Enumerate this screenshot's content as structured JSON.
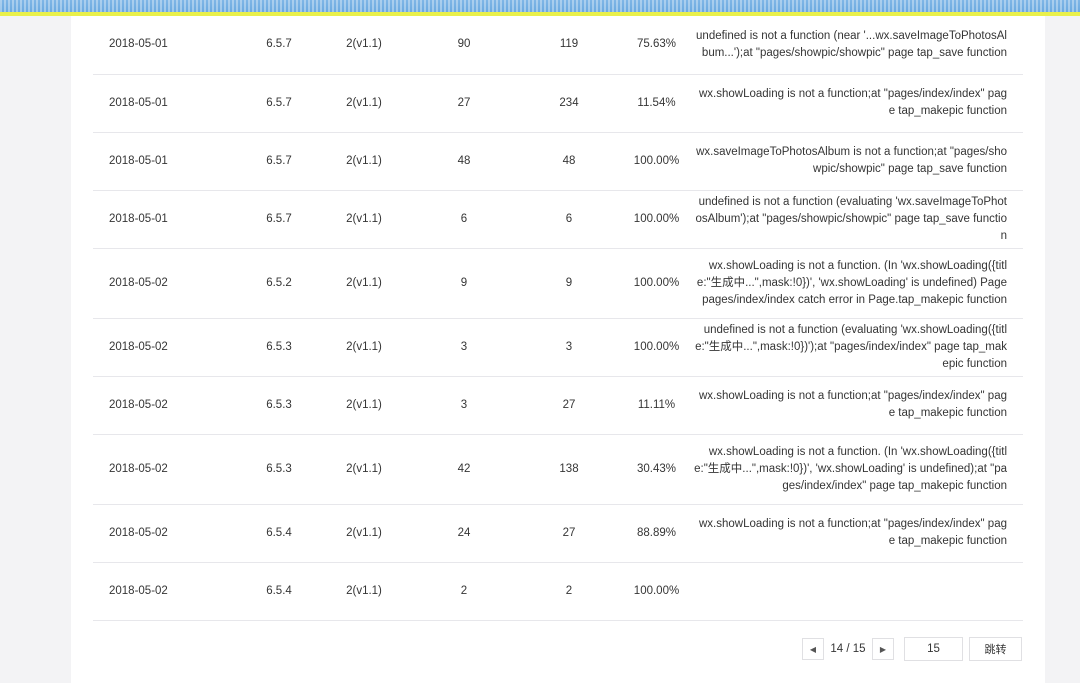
{
  "table": {
    "rows": [
      {
        "date": "2018-05-01",
        "version": "6.5.7",
        "base_lib": "2(v1.1)",
        "count": "90",
        "total": "119",
        "percent": "75.63%",
        "message": "undefined is not a function (near '...wx.saveImageToPhotosAlbum...');at \"pages/showpic/showpic\" page tap_save function"
      },
      {
        "date": "2018-05-01",
        "version": "6.5.7",
        "base_lib": "2(v1.1)",
        "count": "27",
        "total": "234",
        "percent": "11.54%",
        "message": "wx.showLoading is not a function;at \"pages/index/index\" page tap_makepic function"
      },
      {
        "date": "2018-05-01",
        "version": "6.5.7",
        "base_lib": "2(v1.1)",
        "count": "48",
        "total": "48",
        "percent": "100.00%",
        "message": "wx.saveImageToPhotosAlbum is not a function;at \"pages/showpic/showpic\" page tap_save function"
      },
      {
        "date": "2018-05-01",
        "version": "6.5.7",
        "base_lib": "2(v1.1)",
        "count": "6",
        "total": "6",
        "percent": "100.00%",
        "message": "undefined is not a function (evaluating 'wx.saveImageToPhotosAlbum');at \"pages/showpic/showpic\" page tap_save function"
      },
      {
        "date": "2018-05-02",
        "version": "6.5.2",
        "base_lib": "2(v1.1)",
        "count": "9",
        "total": "9",
        "percent": "100.00%",
        "message": "wx.showLoading is not a function. (In 'wx.showLoading({title:\"生成中...\",mask:!0})', 'wx.showLoading' is undefined) Page pages/index/index catch error in Page.tap_makepic function"
      },
      {
        "date": "2018-05-02",
        "version": "6.5.3",
        "base_lib": "2(v1.1)",
        "count": "3",
        "total": "3",
        "percent": "100.00%",
        "message": "undefined is not a function (evaluating 'wx.showLoading({title:\"生成中...\",mask:!0})');at \"pages/index/index\" page tap_makepic function"
      },
      {
        "date": "2018-05-02",
        "version": "6.5.3",
        "base_lib": "2(v1.1)",
        "count": "3",
        "total": "27",
        "percent": "11.11%",
        "message": "wx.showLoading is not a function;at \"pages/index/index\" page tap_makepic function"
      },
      {
        "date": "2018-05-02",
        "version": "6.5.3",
        "base_lib": "2(v1.1)",
        "count": "42",
        "total": "138",
        "percent": "30.43%",
        "message": "wx.showLoading is not a function. (In 'wx.showLoading({title:\"生成中...\",mask:!0})', 'wx.showLoading' is undefined);at \"pages/index/index\" page tap_makepic function"
      },
      {
        "date": "2018-05-02",
        "version": "6.5.4",
        "base_lib": "2(v1.1)",
        "count": "24",
        "total": "27",
        "percent": "88.89%",
        "message": "wx.showLoading is not a function;at \"pages/index/index\" page tap_makepic function"
      },
      {
        "date": "2018-05-02",
        "version": "6.5.4",
        "base_lib": "2(v1.1)",
        "count": "2",
        "total": "2",
        "percent": "100.00%",
        "message": ""
      }
    ]
  },
  "pagination": {
    "prev_icon": "triangle-left-icon",
    "next_icon": "triangle-right-icon",
    "page_label": "14 / 15",
    "jump_value": "15",
    "jump_button_label": "跳转"
  },
  "colors": {
    "top_bar": "#6ba9e0",
    "top_bar_accent": "#e9f04a",
    "row_divider": "#e7e7eb",
    "text": "#353535"
  }
}
